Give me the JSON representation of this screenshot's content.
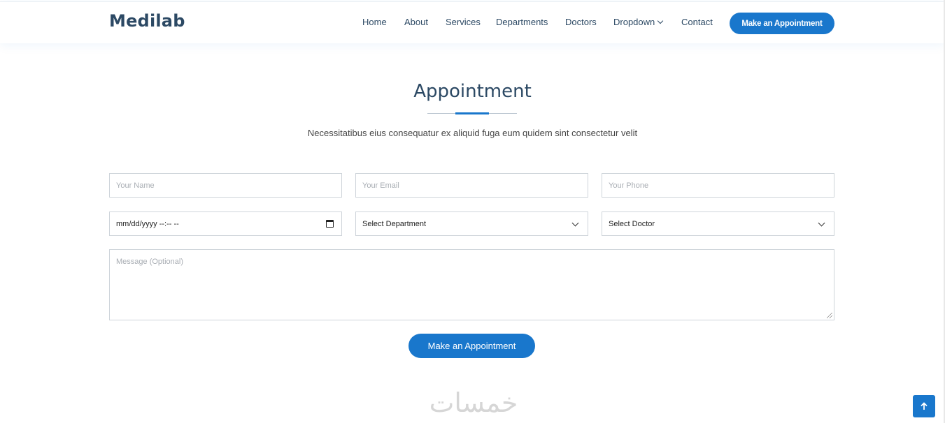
{
  "header": {
    "logo": "Medilab",
    "nav": [
      {
        "label": "Home"
      },
      {
        "label": "About"
      },
      {
        "label": "Services"
      },
      {
        "label": "Departments"
      },
      {
        "label": "Doctors"
      },
      {
        "label": "Dropdown",
        "has_chevron": true
      },
      {
        "label": "Contact"
      }
    ],
    "cta_label": "Make an Appointment"
  },
  "section": {
    "title": "Appointment",
    "subtitle": "Necessitatibus eius consequatur ex aliquid fuga eum quidem sint consectetur velit"
  },
  "form": {
    "name_placeholder": "Your Name",
    "email_placeholder": "Your Email",
    "phone_placeholder": "Your Phone",
    "date_value": "mm/dd/yyyy --:-- --",
    "department_selected": "Select Department",
    "doctor_selected": "Select Doctor",
    "message_placeholder": "Message (Optional)",
    "submit_label": "Make an Appointment"
  },
  "watermark": "خمسات",
  "colors": {
    "accent": "#1977cc",
    "heading": "#2c4964",
    "border": "#ced4da"
  },
  "icons": {
    "dropdown": "chevron-down-icon",
    "calendar": "calendar-icon",
    "back_to_top": "arrow-up-icon"
  }
}
